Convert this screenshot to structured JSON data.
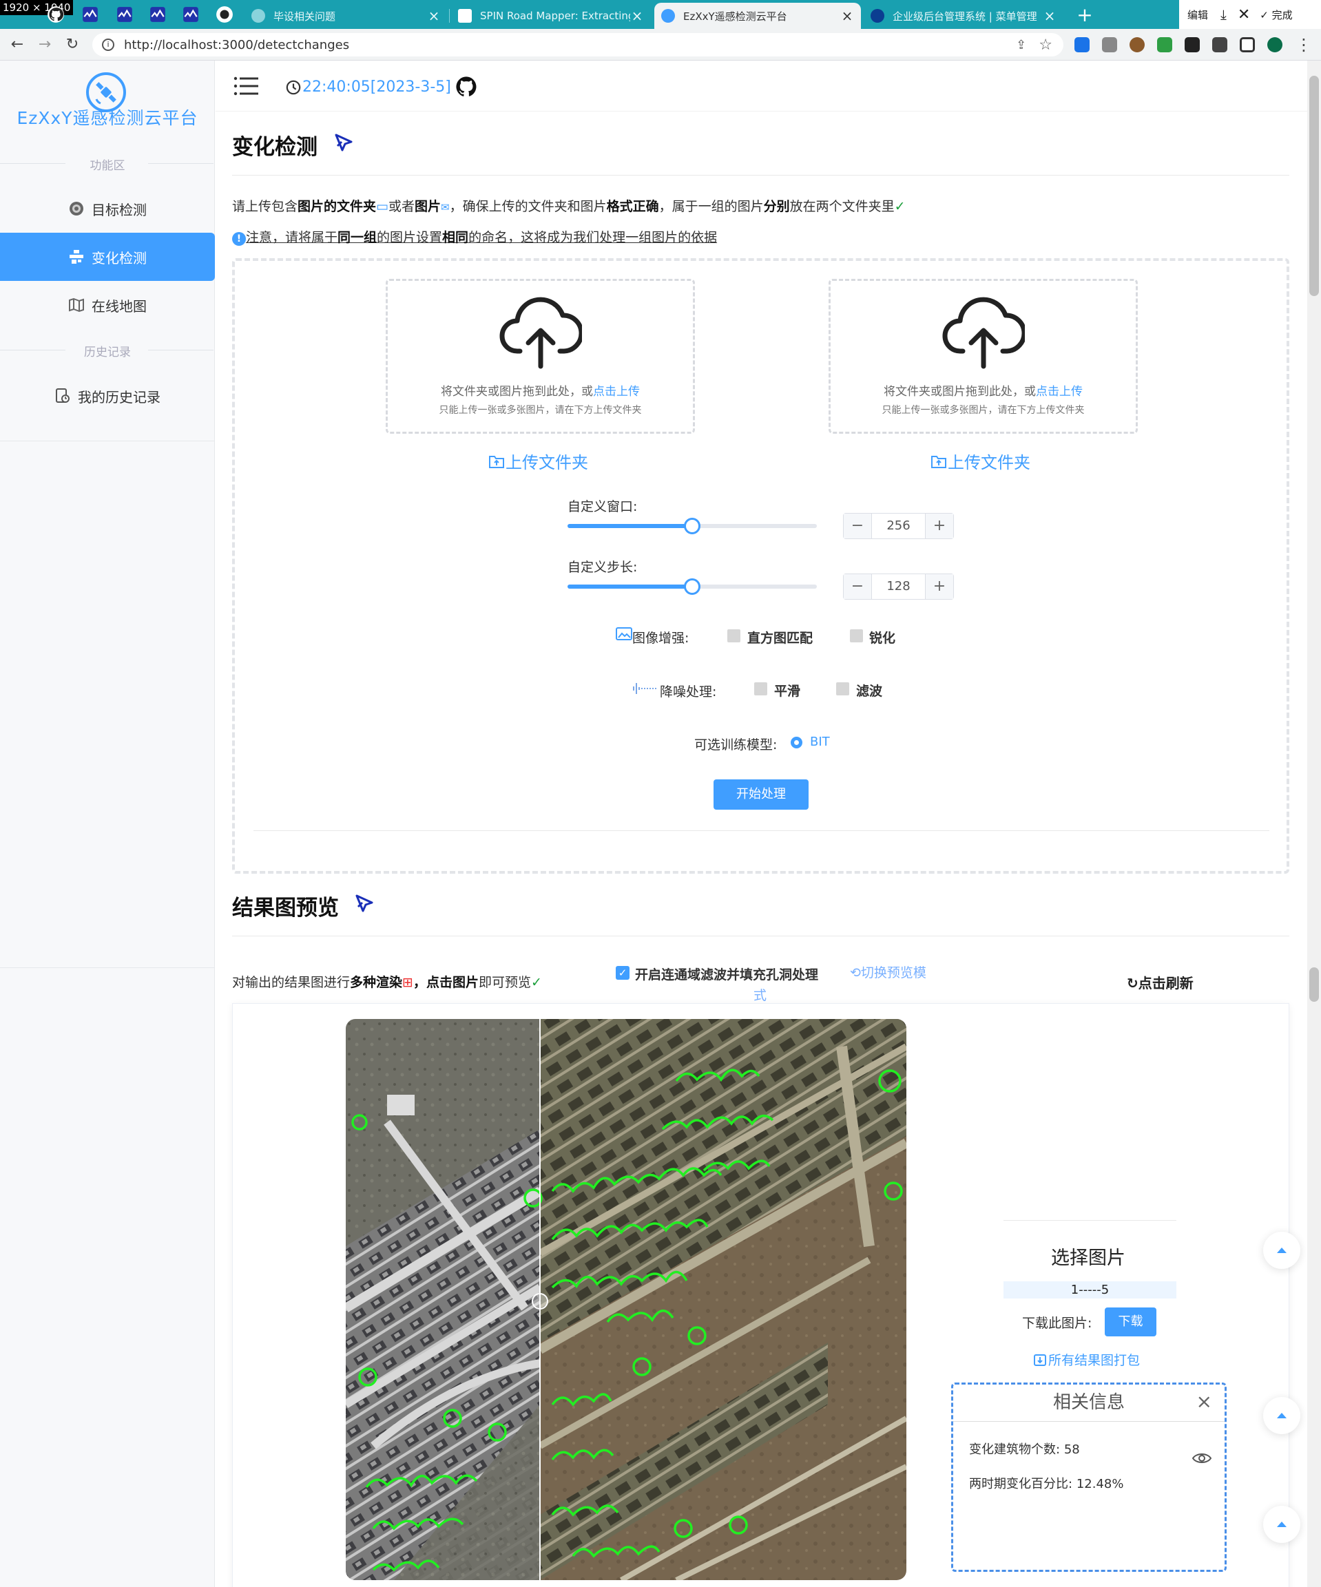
{
  "screen_badge": "1920 × 1040",
  "tabs": [
    {
      "title": "毕设相关问题",
      "close": "×",
      "icon_color": "#8ad3dc",
      "active": false
    },
    {
      "title": "SPIN Road Mapper: Extracting",
      "close": "×",
      "icon_color": "#ffffff",
      "active": false
    },
    {
      "title": "EzXxY遥感检测云平台",
      "close": "×",
      "icon_color": "#409eff",
      "active": true
    },
    {
      "title": "企业级后台管理系统 | 菜单管理",
      "close": "×",
      "icon_color": "#0b3d91",
      "active": false
    }
  ],
  "new_tab": "+",
  "window_controls": {
    "edit": "编辑",
    "done": "完成"
  },
  "url": "http://localhost:3000/detectchanges",
  "sidebar": {
    "brand": "EzXxY遥感检测云平台",
    "section_functions": "功能区",
    "items": [
      {
        "label": "目标检测",
        "icon": "target-icon"
      },
      {
        "label": "变化检测",
        "icon": "change-icon"
      },
      {
        "label": "在线地图",
        "icon": "map-icon"
      }
    ],
    "section_history": "历史记录",
    "history_item": {
      "label": "我的历史记录",
      "icon": "history-icon"
    }
  },
  "topnav": {
    "time": "22:40:05[2023-3-5]"
  },
  "section1": {
    "title": "变化检测",
    "info_line1": {
      "t1": "请上传包含",
      "b1": "图片的文件夹",
      "t2": "或者",
      "b2": "图片",
      "t3": "，确保上传的文件夹和图片",
      "b3": "格式正确",
      "t4": "，属于一组的图片",
      "b4": "分别",
      "t5": "放在两个文件夹里"
    },
    "info_line2": {
      "t1": "注意，请将属于",
      "b1": "同一组",
      "t2": "的图片设置",
      "b2": "相同",
      "t3": "的命名，这将成为我们处理一组图片的依据"
    },
    "upload": {
      "drag_text": "将文件夹或图片拖到此处，或",
      "click_text": "点击上传",
      "sub_text": "只能上传一张或多张图片，请在下方上传文件夹",
      "folder_link": "上传文件夹"
    },
    "window": {
      "label": "自定义窗口:",
      "value": "256",
      "minus": "−",
      "plus": "+",
      "fraction": 0.5
    },
    "stride": {
      "label": "自定义步长:",
      "value": "128",
      "minus": "−",
      "plus": "+",
      "fraction": 0.5
    },
    "enhance": {
      "label": "图像增强:",
      "opt1": "直方图匹配",
      "opt2": "锐化"
    },
    "denoise": {
      "label": "降噪处理:",
      "opt1": "平滑",
      "opt2": "滤波"
    },
    "model": {
      "label": "可选训练模型:",
      "option": "BIT"
    },
    "start_button": "开始处理"
  },
  "section2": {
    "title": "结果图预览",
    "desc": {
      "t1": "对输出的结果图进行",
      "b1": "多种渲染",
      "t2": "，",
      "b2": "点击图片",
      "t3": "即可预览"
    },
    "filter_checkbox": "开启连通域滤波并填充孔洞处理",
    "switch_mode_a": "切换预览模",
    "switch_mode_b": "式",
    "refresh": "点击刷新",
    "select_title": "选择图片",
    "select_value": "1-----5",
    "download_label": "下载此图片:",
    "download_button": "下载",
    "pack_link": "所有结果图打包",
    "info_panel": {
      "title": "相关信息",
      "close": "×",
      "building_label": "变化建筑物个数:",
      "building_value": "58",
      "percent_label": "两时期变化百分比:",
      "percent_value": "12.48%"
    }
  },
  "colors": {
    "accent": "#409eff",
    "tabbar": "#19a0b0",
    "green_mask": "#22ee22"
  }
}
